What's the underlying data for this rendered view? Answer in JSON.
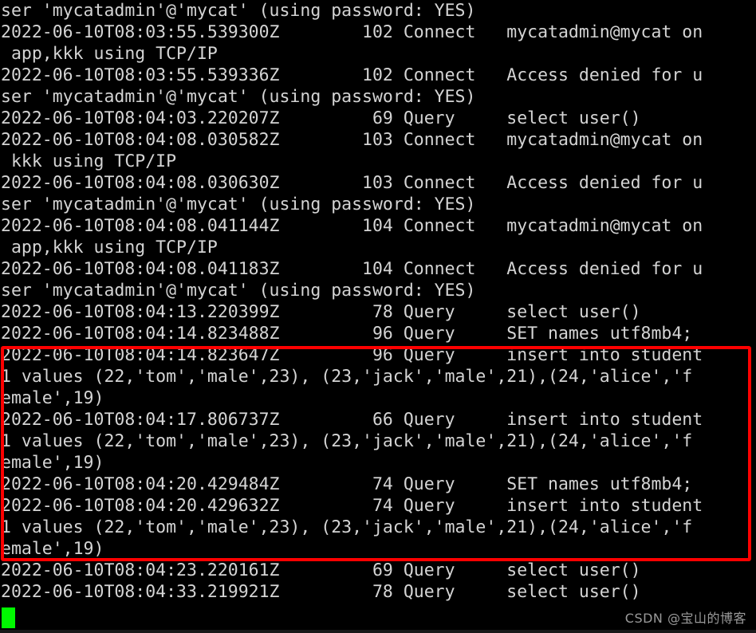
{
  "terminal": {
    "title": "MySQL general log tail",
    "background_color": "#000000",
    "text_color": "#d4d4d4",
    "cursor_color": "#00f900",
    "highlight_color": "#ff0000",
    "lines": [
      "ser 'mycatadmin'@'mycat' (using password: YES)",
      "2022-06-10T08:03:55.539300Z        102 Connect   mycatadmin@mycat on",
      " app,kkk using TCP/IP",
      "2022-06-10T08:03:55.539336Z        102 Connect   Access denied for u",
      "ser 'mycatadmin'@'mycat' (using password: YES)",
      "2022-06-10T08:04:03.220207Z         69 Query     select user()",
      "2022-06-10T08:04:08.030582Z        103 Connect   mycatadmin@mycat on",
      " kkk using TCP/IP",
      "2022-06-10T08:04:08.030630Z        103 Connect   Access denied for u",
      "ser 'mycatadmin'@'mycat' (using password: YES)",
      "2022-06-10T08:04:08.041144Z        104 Connect   mycatadmin@mycat on",
      " app,kkk using TCP/IP",
      "2022-06-10T08:04:08.041183Z        104 Connect   Access denied for u",
      "ser 'mycatadmin'@'mycat' (using password: YES)",
      "2022-06-10T08:04:13.220399Z         78 Query     select user()",
      "2022-06-10T08:04:14.823488Z         96 Query     SET names utf8mb4;",
      "2022-06-10T08:04:14.823647Z         96 Query     insert into student",
      "1 values (22,'tom','male',23), (23,'jack','male',21),(24,'alice','f",
      "emale',19)",
      "2022-06-10T08:04:17.806737Z         66 Query     insert into student",
      "1 values (22,'tom','male',23), (23,'jack','male',21),(24,'alice','f",
      "emale',19)",
      "2022-06-10T08:04:20.429484Z         74 Query     SET names utf8mb4;",
      "2022-06-10T08:04:20.429632Z         74 Query     insert into student",
      "1 values (22,'tom','male',23), (23,'jack','male',21),(24,'alice','f",
      "emale',19)",
      "2022-06-10T08:04:23.220161Z         69 Query     select user()",
      "2022-06-10T08:04:33.219921Z         78 Query     select user()"
    ],
    "highlight": {
      "label": "red-annotation-box",
      "first_line_index": 16,
      "last_line_index": 25,
      "color": "#ff0000"
    },
    "cursor": {
      "label": "block-cursor",
      "line_index": 27,
      "column": 0
    }
  },
  "watermark": {
    "text": "CSDN @宝山的博客"
  }
}
